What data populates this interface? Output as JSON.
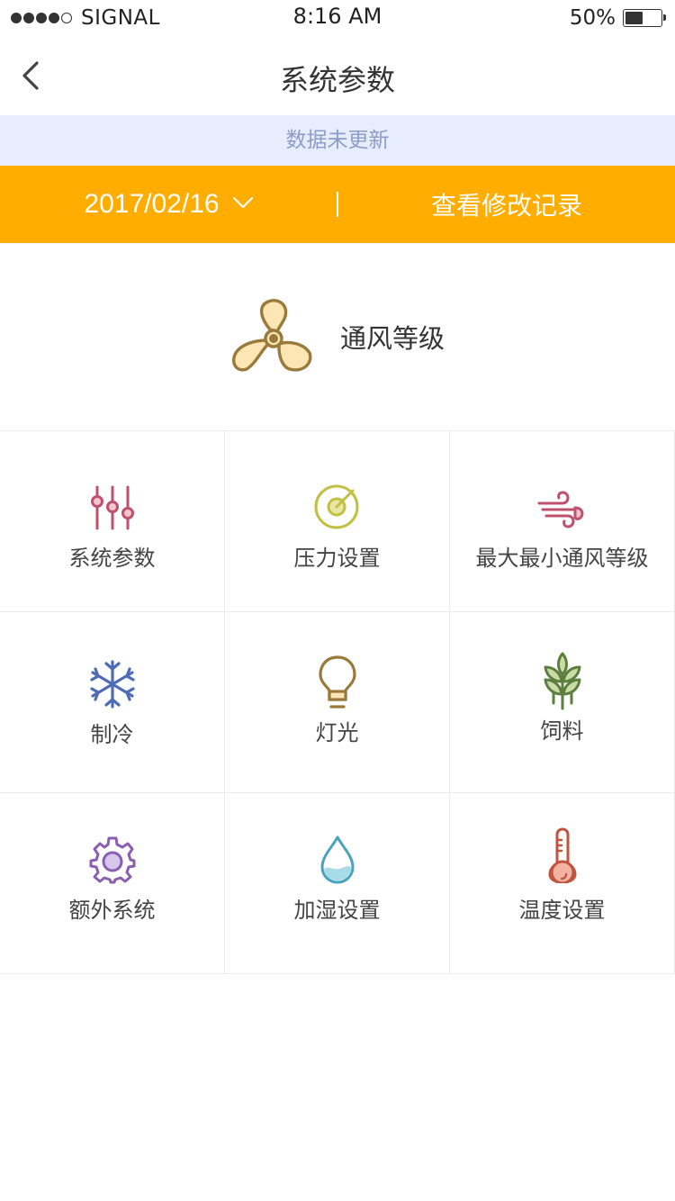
{
  "status_bar": {
    "carrier": "SIGNAL",
    "time": "8:16 AM",
    "battery": "50%",
    "battery_level": 0.5
  },
  "nav": {
    "title": "系统参数",
    "back_icon": "chevron-left-icon"
  },
  "notice": {
    "text": "数据未更新"
  },
  "date_bar": {
    "date": "2017/02/16",
    "history_label": "查看修改记录",
    "background": "#ffad00"
  },
  "hero": {
    "label": "通风等级",
    "icon": "fan-icon"
  },
  "menu": {
    "items": [
      {
        "label": "系统参数",
        "icon": "sliders-icon",
        "color": "#c0516e"
      },
      {
        "label": "压力设置",
        "icon": "gauge-icon",
        "color": "#c1c043"
      },
      {
        "label": "最大最小通风等级",
        "icon": "wind-icon",
        "color": "#c0516e"
      },
      {
        "label": "制冷",
        "icon": "snowflake-icon",
        "color": "#4e6bb8"
      },
      {
        "label": "灯光",
        "icon": "lightbulb-icon",
        "color": "#9a7a3a"
      },
      {
        "label": "饲料",
        "icon": "wheat-icon",
        "color": "#5d7f3e"
      },
      {
        "label": "额外系统",
        "icon": "gear-icon",
        "color": "#8a5fb0"
      },
      {
        "label": "加湿设置",
        "icon": "water-drop-icon",
        "color": "#4aa3bd"
      },
      {
        "label": "温度设置",
        "icon": "thermometer-icon",
        "color": "#c0553f"
      }
    ]
  }
}
